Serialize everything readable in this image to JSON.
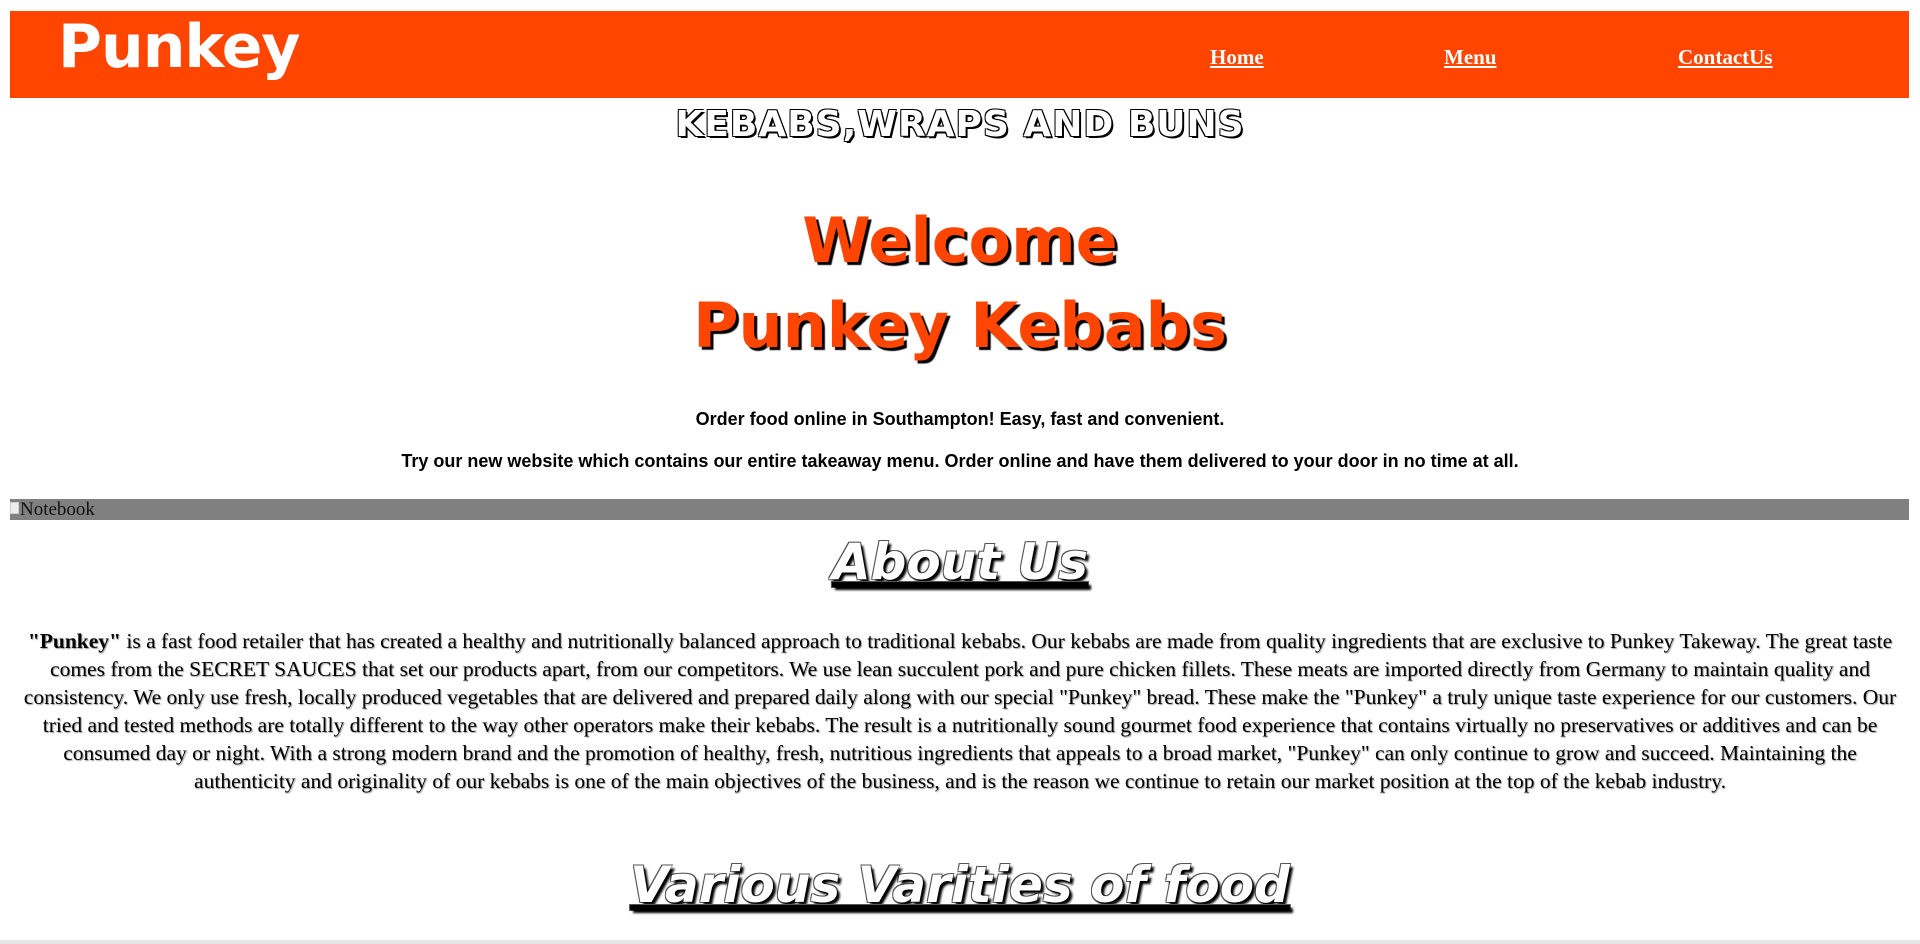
{
  "header": {
    "brand": "Punkey",
    "nav": {
      "home": "Home",
      "menu": "Menu",
      "contact": "ContactUs"
    }
  },
  "hero": {
    "tagline": "KEBABS,WRAPS AND BUNS",
    "welcome": "Welcome",
    "title": "Punkey Kebabs",
    "intro_1": "Order food online in Southampton! Easy, fast and convenient.",
    "intro_2": "Try our new website which contains our entire takeaway menu. Order online and have them delivered to your door in no time at all."
  },
  "banner_image": {
    "alt": "Notebook"
  },
  "about": {
    "heading": "About Us",
    "brand_quote": "\"Punkey\"",
    "body": " is a fast food retailer that has created a healthy and nutritionally balanced approach to traditional kebabs. Our kebabs are made from quality ingredients that are exclusive to Punkey Takeway. The great taste comes from the SECRET SAUCES that set our products apart, from our competitors. We use lean succulent pork and pure chicken fillets. These meats are imported directly from Germany to maintain quality and consistency. We only use fresh, locally produced vegetables that are delivered and prepared daily along with our special \"Punkey\" bread. These make the \"Punkey\" a truly unique taste experience for our customers. Our tried and tested methods are totally different to the way other operators make their kebabs. The result is a nutritionally sound gourmet food experience that contains virtually no preservatives or additives and can be consumed day or night. With a strong modern brand and the promotion of healthy, fresh, nutritious ingredients that appeals to a broad market, \"Punkey\" can only continue to grow and succeed. Maintaining the authenticity and originality of our kebabs is one of the main objectives of the business, and is the reason we continue to retain our market position at the top of the kebab industry."
  },
  "varieties": {
    "heading": "Various Varities of food"
  },
  "colors": {
    "brand_orange": "#ff4500",
    "strip_gray": "#808080"
  }
}
